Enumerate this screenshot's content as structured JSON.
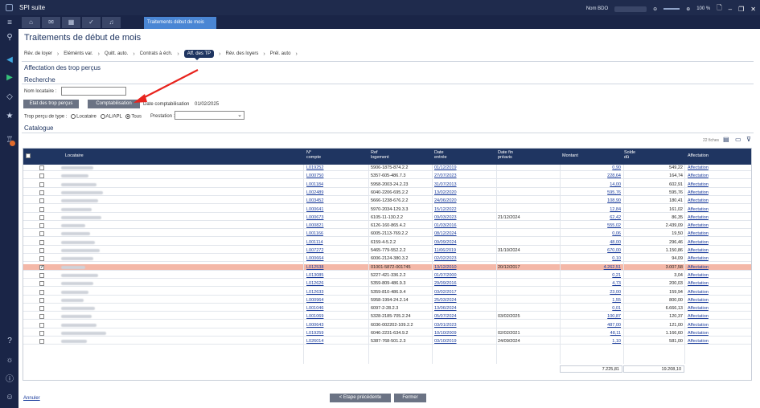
{
  "app": {
    "title": "SPI suite",
    "user": "Nom BDO",
    "zoom": "100 %"
  },
  "tabs": {
    "active": "Traitements début de mois"
  },
  "page": {
    "title": "Traitements de début de mois"
  },
  "steps": [
    "Rév. de loyer",
    "Eléménts var.",
    "Quitt. auto.",
    "Contrats à éch.",
    "Aff. des TP",
    "Rév. des loyers",
    "Prél. auto"
  ],
  "section": {
    "title": "Affectation des trop perçus",
    "search": "Recherche",
    "catalogue": "Catalogue"
  },
  "search": {
    "locataire_label": "Nom locataire :",
    "locataire_value": ""
  },
  "buttons": {
    "etat": "Etat des trop perçus",
    "compta": "Comptabilisation",
    "prev": "< Etape précédente",
    "close": "Fermer",
    "cancel": "Annuler"
  },
  "compta": {
    "date_label": "Date comptabilisation",
    "date_value": "01/02/2025"
  },
  "filters": {
    "type_label": "Trop perçu de type :",
    "opt1": "Locataire",
    "opt2": "AL/APL",
    "opt3": "Tous",
    "prestation_label": "Prestation :",
    "prestation_value": ""
  },
  "grid": {
    "count": "22 fiches",
    "headers": {
      "locataire": "Locataire",
      "compte": "N°\ncompte",
      "ref": "Ref\nlogement",
      "date_entree": "Date\nentrée",
      "date_fin": "Date fin\npréavis",
      "montant": "Montant",
      "solde": "Solde\ndû",
      "affectation": "Affectation"
    },
    "rows": [
      {
        "compte": "L019252",
        "ref": "5906-1875-874.2.2",
        "entree": "01/12/2019",
        "fin": "",
        "montant": "0,90",
        "solde": "549,22",
        "aff": "Affectation",
        "w": 40,
        "checked": false,
        "hl": false
      },
      {
        "compte": "L000750",
        "ref": "5357-605-486.7.3",
        "entree": "27/07/2023",
        "fin": "",
        "montant": "228,64",
        "solde": "164,74",
        "aff": "Affectation",
        "w": 34,
        "checked": false,
        "hl": false
      },
      {
        "compte": "L001184",
        "ref": "5958-2003-24.2.23",
        "entree": "31/07/2013",
        "fin": "",
        "montant": "14,00",
        "solde": "602,91",
        "aff": "Affectation",
        "w": 44,
        "checked": false,
        "hl": false
      },
      {
        "compte": "L002489",
        "ref": "6040-2206-695.2.2",
        "entree": "13/02/2020",
        "fin": "",
        "montant": "595,76",
        "solde": "595,76",
        "aff": "Affectation",
        "w": 52,
        "checked": false,
        "hl": false
      },
      {
        "compte": "L003452",
        "ref": "5666-1238-676.2.2",
        "entree": "24/06/2020",
        "fin": "",
        "montant": "108,90",
        "solde": "180,41",
        "aff": "Affectation",
        "w": 46,
        "checked": false,
        "hl": false
      },
      {
        "compte": "L000641",
        "ref": "5970-2034-129.3.3",
        "entree": "15/12/2022",
        "fin": "",
        "montant": "12,84",
        "solde": "161,02",
        "aff": "Affectation",
        "w": 38,
        "checked": false,
        "hl": false
      },
      {
        "compte": "L000673",
        "ref": "6105-11-130.2.2",
        "entree": "09/03/2023",
        "fin": "21/12/2024",
        "montant": "62,42",
        "solde": "86,35",
        "aff": "Affectation",
        "w": 50,
        "checked": false,
        "hl": false
      },
      {
        "compte": "L000821",
        "ref": "6126-160-865.4.2",
        "entree": "01/03/2016",
        "fin": "",
        "montant": "555,02",
        "solde": "2.439,09",
        "aff": "Affectation",
        "w": 30,
        "checked": false,
        "hl": false
      },
      {
        "compte": "L001166",
        "ref": "6005-2113-769.2.2",
        "entree": "08/12/2024",
        "fin": "",
        "montant": "0,06",
        "solde": "19,50",
        "aff": "Affectation",
        "w": 36,
        "checked": false,
        "hl": false
      },
      {
        "compte": "L001114",
        "ref": "6159-4-5.2.2",
        "entree": "09/09/2024",
        "fin": "",
        "montant": "48,00",
        "solde": "296,46",
        "aff": "Affectation",
        "w": 42,
        "checked": false,
        "hl": false
      },
      {
        "compte": "L007272",
        "ref": "5465-779-552.2.2",
        "entree": "11/06/2019",
        "fin": "31/10/2024",
        "montant": "670,00",
        "solde": "1.150,86",
        "aff": "Affectation",
        "w": 48,
        "checked": false,
        "hl": false
      },
      {
        "compte": "L000664",
        "ref": "6006-2124-380.3.2",
        "entree": "02/02/2023",
        "fin": "",
        "montant": "0,10",
        "solde": "94,09",
        "aff": "Affectation",
        "w": 40,
        "checked": false,
        "hl": false
      },
      {
        "compte": "L012538",
        "ref": "01001-5872-001745",
        "entree": "13/12/2010",
        "fin": "20/12/2017",
        "montant": "4.262,51",
        "solde": "3.007,58",
        "aff": "Affectation",
        "w": 30,
        "checked": true,
        "hl": true
      },
      {
        "compte": "L013085",
        "ref": "5227-421-336.2.2",
        "entree": "01/07/2000",
        "fin": "",
        "montant": "0,21",
        "solde": "3,04",
        "aff": "Affectation",
        "w": 46,
        "checked": false,
        "hl": false
      },
      {
        "compte": "L012626",
        "ref": "5359-809-486.9.3",
        "entree": "29/09/2016",
        "fin": "",
        "montant": "4,73",
        "solde": "200,03",
        "aff": "Affectation",
        "w": 40,
        "checked": false,
        "hl": false
      },
      {
        "compte": "L012633",
        "ref": "5359-810-486.9.4",
        "entree": "03/02/2017",
        "fin": "",
        "montant": "23,00",
        "solde": "159,94",
        "aff": "Affectation",
        "w": 34,
        "checked": false,
        "hl": false
      },
      {
        "compte": "L000964",
        "ref": "5958-1994-24.2.14",
        "entree": "25/03/2024",
        "fin": "",
        "montant": "1,55",
        "solde": "800,00",
        "aff": "Affectation",
        "w": 28,
        "checked": false,
        "hl": false
      },
      {
        "compte": "L001046",
        "ref": "6097-2-28.2.3",
        "entree": "13/06/2024",
        "fin": "",
        "montant": "0,01",
        "solde": "6.666,13",
        "aff": "Affectation",
        "w": 42,
        "checked": false,
        "hl": false
      },
      {
        "compte": "L001069",
        "ref": "5328-2185-705.2.24",
        "entree": "05/07/2024",
        "fin": "03/02/2025",
        "montant": "100,87",
        "solde": "120,37",
        "aff": "Affectation",
        "w": 38,
        "checked": false,
        "hl": false
      },
      {
        "compte": "L000643",
        "ref": "6036-002202-109.2.2",
        "entree": "03/01/2023",
        "fin": "",
        "montant": "487,00",
        "solde": "121,00",
        "aff": "Affectation",
        "w": 44,
        "checked": false,
        "hl": false
      },
      {
        "compte": "L019259",
        "ref": "6046-2231-634.9.2",
        "entree": "10/10/2009",
        "fin": "02/02/2021",
        "montant": "48,11",
        "solde": "1.166,60",
        "aff": "Affectation",
        "w": 56,
        "checked": false,
        "hl": false
      },
      {
        "compte": "L026014",
        "ref": "5387-768-501.2.3",
        "entree": "03/10/2019",
        "fin": "24/09/2024",
        "montant": "1,10",
        "solde": "581,00",
        "aff": "Affectation",
        "w": 32,
        "checked": false,
        "hl": false
      }
    ],
    "total_montant": "7.225,81",
    "total_solde": "19.208,10"
  }
}
